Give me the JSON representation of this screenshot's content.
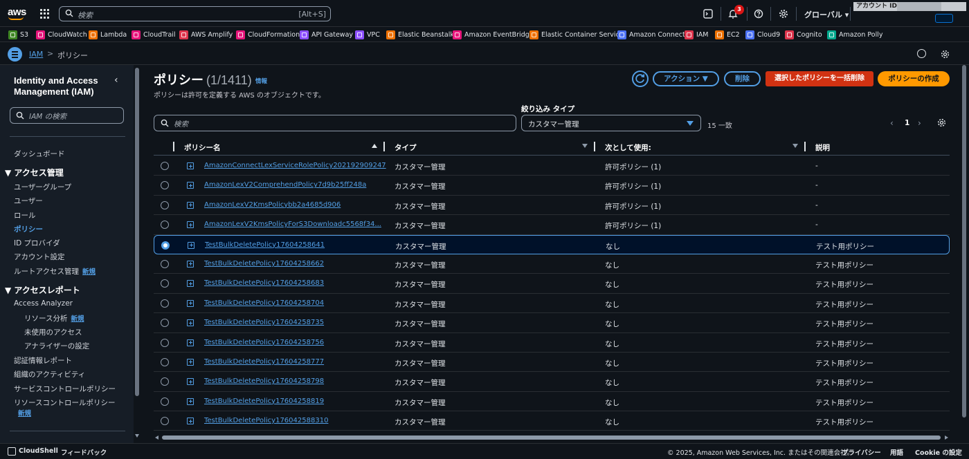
{
  "topnav": {
    "logo": "aws",
    "search_placeholder": "検索",
    "search_shortcut": "[Alt+S]",
    "notification_count": "3",
    "region": "グローバル ▾",
    "account_label": "アカウント ID:"
  },
  "favorites": [
    {
      "label": "S3",
      "color": "#3f8624"
    },
    {
      "label": "CloudWatch",
      "color": "#e7157b"
    },
    {
      "label": "Lambda",
      "color": "#ed7100"
    },
    {
      "label": "CloudTrail",
      "color": "#e7157b"
    },
    {
      "label": "AWS Amplify",
      "color": "#dd344c"
    },
    {
      "label": "CloudFormation",
      "color": "#e7157b"
    },
    {
      "label": "API Gateway",
      "color": "#8c4fff"
    },
    {
      "label": "VPC",
      "color": "#8c4fff"
    },
    {
      "label": "Elastic Beanstalk",
      "color": "#ed7100"
    },
    {
      "label": "Amazon EventBridge",
      "color": "#e7157b"
    },
    {
      "label": "Elastic Container Service",
      "color": "#ed7100"
    },
    {
      "label": "Amazon Connect",
      "color": "#4d72f3"
    },
    {
      "label": "IAM",
      "color": "#dd344c"
    },
    {
      "label": "EC2",
      "color": "#ed7100"
    },
    {
      "label": "Cloud9",
      "color": "#4d72f3"
    },
    {
      "label": "Cognito",
      "color": "#dd344c"
    },
    {
      "label": "Amazon Polly",
      "color": "#01a88d"
    }
  ],
  "breadcrumb": {
    "root": "IAM",
    "sep": ">",
    "current": "ポリシー"
  },
  "sidebar": {
    "title": "Identity and Access Management (IAM)",
    "search_placeholder": "IAM の検索",
    "dashboard": "ダッシュボード",
    "section_access": "▼ アクセス管理",
    "access_items": [
      "ユーザーグループ",
      "ユーザー",
      "ロール",
      "ポリシー",
      "ID プロバイダ",
      "アカウント設定",
      "ルートアクセス管理"
    ],
    "new_badge": "新規",
    "section_reports": "▼ アクセスレポート",
    "analyzer": "Access Analyzer",
    "analyzer_items": [
      "リソース分析",
      "未使用のアクセス",
      "アナライザーの設定"
    ],
    "report_items": [
      "認証情報レポート",
      "組織のアクティビティ",
      "サービスコントロールポリシー",
      "リソースコントロールポリシー"
    ]
  },
  "main": {
    "title": "ポリシー",
    "count": "(1/1411)",
    "info": "情報",
    "description": "ポリシーは許可を定義する AWS のオブジェクトです。",
    "btn_actions": "アクション ▼",
    "btn_delete": "削除",
    "btn_bulk_delete": "選択したポリシーを一括削除",
    "btn_create": "ポリシーの作成",
    "filter_label": "絞り込み タイプ",
    "search_placeholder": "検索",
    "filter_value": "カスタマー管理",
    "match_count": "15 一致",
    "page": "1",
    "prev": "‹",
    "next": "›"
  },
  "table": {
    "headers": [
      "ポリシー名",
      "タイプ",
      "次として使用:",
      "説明"
    ],
    "rows": [
      {
        "name": "AmazonConnectLexServiceRolePolicy202192909247",
        "type": "カスタマー管理",
        "used": "許可ポリシー (1)",
        "desc": "-",
        "selected": false
      },
      {
        "name": "AmazonLexV2ComprehendPolicy7d9b25ff248a",
        "type": "カスタマー管理",
        "used": "許可ポリシー (1)",
        "desc": "-",
        "selected": false
      },
      {
        "name": "AmazonLexV2KmsPolicybb2a4685d906",
        "type": "カスタマー管理",
        "used": "許可ポリシー (1)",
        "desc": "-",
        "selected": false
      },
      {
        "name": "AmazonLexV2KmsPolicyForS3Downloadc5568f34...",
        "type": "カスタマー管理",
        "used": "許可ポリシー (1)",
        "desc": "-",
        "selected": false
      },
      {
        "name": "TestBulkDeletePolicy17604258641",
        "type": "カスタマー管理",
        "used": "なし",
        "desc": "テスト用ポリシー",
        "selected": true
      },
      {
        "name": "TestBulkDeletePolicy17604258662",
        "type": "カスタマー管理",
        "used": "なし",
        "desc": "テスト用ポリシー",
        "selected": false
      },
      {
        "name": "TestBulkDeletePolicy17604258683",
        "type": "カスタマー管理",
        "used": "なし",
        "desc": "テスト用ポリシー",
        "selected": false
      },
      {
        "name": "TestBulkDeletePolicy17604258704",
        "type": "カスタマー管理",
        "used": "なし",
        "desc": "テスト用ポリシー",
        "selected": false
      },
      {
        "name": "TestBulkDeletePolicy17604258735",
        "type": "カスタマー管理",
        "used": "なし",
        "desc": "テスト用ポリシー",
        "selected": false
      },
      {
        "name": "TestBulkDeletePolicy17604258756",
        "type": "カスタマー管理",
        "used": "なし",
        "desc": "テスト用ポリシー",
        "selected": false
      },
      {
        "name": "TestBulkDeletePolicy17604258777",
        "type": "カスタマー管理",
        "used": "なし",
        "desc": "テスト用ポリシー",
        "selected": false
      },
      {
        "name": "TestBulkDeletePolicy17604258798",
        "type": "カスタマー管理",
        "used": "なし",
        "desc": "テスト用ポリシー",
        "selected": false
      },
      {
        "name": "TestBulkDeletePolicy17604258819",
        "type": "カスタマー管理",
        "used": "なし",
        "desc": "テスト用ポリシー",
        "selected": false
      },
      {
        "name": "TestBulkDeletePolicy176042588310",
        "type": "カスタマー管理",
        "used": "なし",
        "desc": "テスト用ポリシー",
        "selected": false
      }
    ]
  },
  "footer": {
    "cloudshell": "CloudShell",
    "feedback": "フィードバック",
    "copyright": "© 2025, Amazon Web Services, Inc. またはその関連会社。",
    "privacy": "プライバシー",
    "terms": "用語",
    "cookie": "Cookie の設定"
  }
}
